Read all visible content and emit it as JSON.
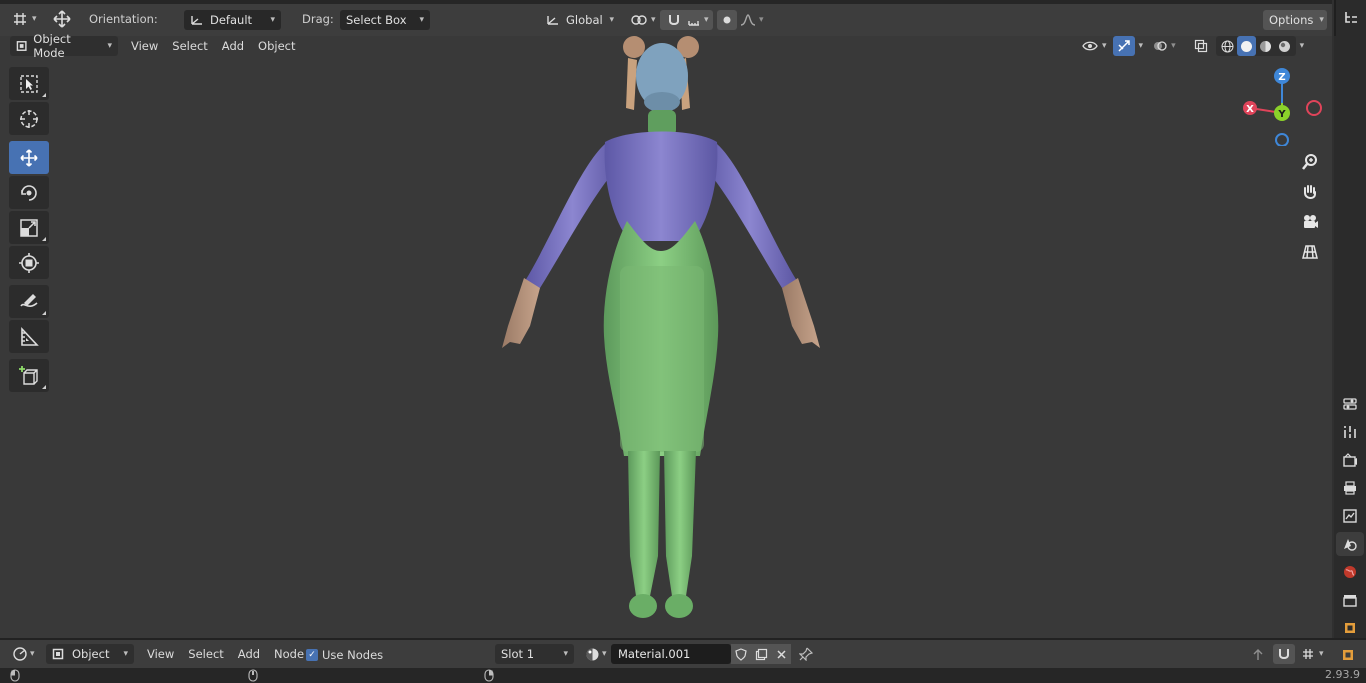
{
  "header": {
    "orientation_label": "Orientation:",
    "orientation_value": "Default",
    "drag_label": "Drag:",
    "drag_value": "Select Box",
    "transform_orientation": "Global",
    "options_label": "Options"
  },
  "viewport_header": {
    "mode": "Object Mode",
    "menus": [
      "View",
      "Select",
      "Add",
      "Object"
    ]
  },
  "gizmo": {
    "axis_z": "Z",
    "axis_x": "X",
    "axis_y": "Y",
    "color_x": "#e0445a",
    "color_y": "#8bd12a",
    "color_z": "#3f87d8"
  },
  "bottom_header": {
    "editor_type": "Object",
    "menus": [
      "View",
      "Select",
      "Add",
      "Node"
    ],
    "use_nodes_label": "Use Nodes",
    "slot": "Slot 1",
    "material": "Material.001"
  },
  "status": {
    "version": "2.93.9"
  },
  "colors": {
    "accent": "#4772b3",
    "viewport_bg": "#393939",
    "header_bg": "#3d3d3d"
  },
  "icons": {
    "tools": [
      "select-box-icon",
      "cursor-icon",
      "move-icon",
      "rotate-icon",
      "scale-icon",
      "transform-icon",
      "annotate-icon",
      "measure-icon",
      "add-cube-icon"
    ],
    "nav": [
      "zoom-icon",
      "pan-hand-icon",
      "camera-icon",
      "grid-view-icon"
    ],
    "properties": [
      "tool-settings-icon",
      "render-icon",
      "output-icon",
      "view-layer-icon",
      "scene-icon",
      "world-icon",
      "collection-icon",
      "object-icon"
    ]
  }
}
